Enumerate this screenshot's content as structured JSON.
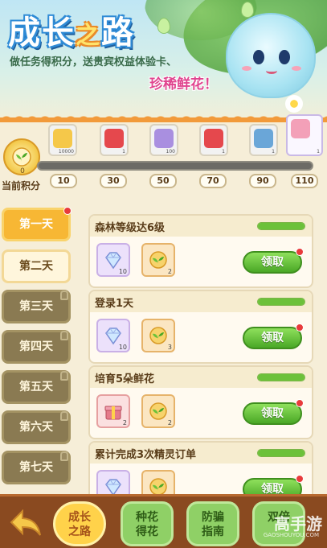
{
  "banner": {
    "title_part1": "成长",
    "title_part2": "之",
    "title_part3": "路",
    "subtitle_line1": "做任务得积分，送贵宾权益体验卡、",
    "subtitle_line2": "珍稀鲜花！"
  },
  "progress": {
    "current_points": "0",
    "label": "当前积分",
    "fill_fraction": 0.0,
    "milestones": [
      "10",
      "30",
      "50",
      "70",
      "90",
      "110"
    ],
    "rewards": [
      {
        "icon": "gold-coin-icon",
        "qty": "10000",
        "color": "#f5c84a"
      },
      {
        "icon": "red-card-icon",
        "qty": "1",
        "color": "#e5484d"
      },
      {
        "icon": "diamond-icon",
        "qty": "100",
        "color": "#a98fe0"
      },
      {
        "icon": "red-card-icon",
        "qty": "1",
        "color": "#e5484d"
      },
      {
        "icon": "membership-card-icon",
        "qty": "1",
        "color": "#6aa6d8"
      },
      {
        "icon": "flower-pot-icon",
        "qty": "1",
        "color": "#f3a0b8"
      }
    ]
  },
  "days": [
    {
      "label": "第一天",
      "state": "active"
    },
    {
      "label": "第二天",
      "state": "open"
    },
    {
      "label": "第三天",
      "state": "locked"
    },
    {
      "label": "第四天",
      "state": "locked"
    },
    {
      "label": "第五天",
      "state": "locked"
    },
    {
      "label": "第六天",
      "state": "locked"
    },
    {
      "label": "第七天",
      "state": "locked"
    }
  ],
  "tasks": [
    {
      "title": "森林等级达6级",
      "progress_fraction": 1.0,
      "claim_label": "领取",
      "items": [
        {
          "icon": "diamond-icon",
          "qty": "10"
        },
        {
          "icon": "seed-icon",
          "qty": "2"
        }
      ]
    },
    {
      "title": "登录1天",
      "progress_fraction": 1.0,
      "claim_label": "领取",
      "items": [
        {
          "icon": "diamond-icon",
          "qty": "10"
        },
        {
          "icon": "seed-icon",
          "qty": "3"
        }
      ]
    },
    {
      "title": "培育5朵鲜花",
      "progress_fraction": 1.0,
      "claim_label": "领取",
      "items": [
        {
          "icon": "gift-box-icon",
          "qty": "2"
        },
        {
          "icon": "seed-icon",
          "qty": "2"
        }
      ]
    },
    {
      "title": "累计完成3次精灵订单",
      "progress_fraction": 1.0,
      "claim_label": "领取",
      "items": [
        {
          "icon": "diamond-icon",
          "qty": ""
        },
        {
          "icon": "seed-icon",
          "qty": ""
        }
      ]
    }
  ],
  "bottom_nav": {
    "tabs": [
      {
        "label": "成长之路",
        "line1": "成长",
        "line2": "之路",
        "active": true
      },
      {
        "label": "种花得花",
        "line1": "种花",
        "line2": "得花",
        "active": false
      },
      {
        "label": "防骗指南",
        "line1": "防骗",
        "line2": "指南",
        "active": false
      },
      {
        "label": "双倍",
        "line1": "双倍",
        "line2": "",
        "active": false
      }
    ]
  },
  "watermark": {
    "text": "高手游",
    "sub": "GAOSHOUYOU.COM"
  }
}
